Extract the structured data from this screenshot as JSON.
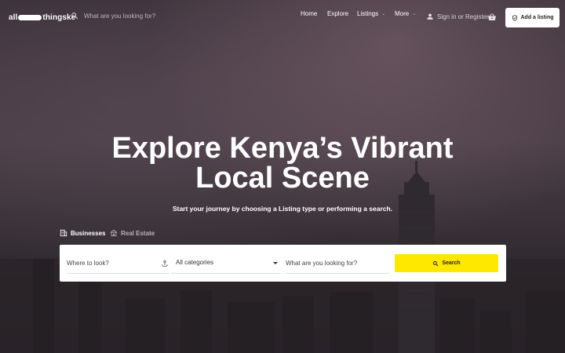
{
  "header": {
    "logo_left": "all",
    "logo_right": "thingske",
    "search_placeholder": "What are you looking for?",
    "nav": [
      {
        "label": "Home"
      },
      {
        "label": "Explore"
      },
      {
        "label": "Listings"
      },
      {
        "label": "More"
      }
    ],
    "signin_label": "Sign in or Register",
    "add_listing_label": "Add a listing"
  },
  "hero": {
    "title_line1": "Explore Kenya’s Vibrant",
    "title_line2": "Local Scene",
    "subtitle": "Start your journey by choosing a Listing type or performing a search."
  },
  "tabs": [
    {
      "label": "Businesses",
      "active": true
    },
    {
      "label": "Real Estate",
      "active": false
    }
  ],
  "search_panel": {
    "where_placeholder": "Where to look?",
    "category_value": "All categories",
    "what_placeholder": "What are you looking for?",
    "search_label": "Search"
  },
  "colors": {
    "accent": "#ffe800",
    "header_button_bg": "#ffffff"
  },
  "icons": {
    "search": "search-icon",
    "user": "user-icon",
    "basket": "basket-icon",
    "shield": "shield-check-icon",
    "building": "building-icon",
    "house": "house-icon",
    "locate": "locate-icon"
  }
}
